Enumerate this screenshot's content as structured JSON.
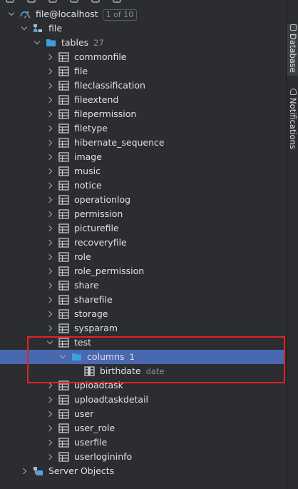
{
  "datasource": {
    "name": "file@localhost",
    "counter": "1 of 10"
  },
  "schema": {
    "name": "file"
  },
  "tables_group": {
    "label": "tables",
    "count": "27"
  },
  "tables": [
    {
      "name": "commonfile"
    },
    {
      "name": "file"
    },
    {
      "name": "fileclassification"
    },
    {
      "name": "fileextend"
    },
    {
      "name": "filepermission"
    },
    {
      "name": "filetype"
    },
    {
      "name": "hibernate_sequence"
    },
    {
      "name": "image"
    },
    {
      "name": "music"
    },
    {
      "name": "notice"
    },
    {
      "name": "operationlog"
    },
    {
      "name": "permission"
    },
    {
      "name": "picturefile"
    },
    {
      "name": "recoveryfile"
    },
    {
      "name": "role"
    },
    {
      "name": "role_permission"
    },
    {
      "name": "share"
    },
    {
      "name": "sharefile"
    },
    {
      "name": "storage"
    },
    {
      "name": "sysparam"
    },
    {
      "name": "test"
    },
    {
      "name": "uploadtask"
    },
    {
      "name": "uploadtaskdetail"
    },
    {
      "name": "user"
    },
    {
      "name": "user_role"
    },
    {
      "name": "userfile"
    },
    {
      "name": "userlogininfo"
    }
  ],
  "test_table": {
    "columns_label": "columns",
    "columns_count": "1",
    "column": {
      "name": "birthdate",
      "type": "date"
    }
  },
  "server_objects": {
    "label": "Server Objects"
  },
  "side_tabs": {
    "database": "Database",
    "notifications": "Notifications"
  },
  "colors": {
    "background": "#2b2d30",
    "selection": "#4a68b0",
    "highlight_box": "#e02128",
    "folder": "#3d9fe0"
  }
}
